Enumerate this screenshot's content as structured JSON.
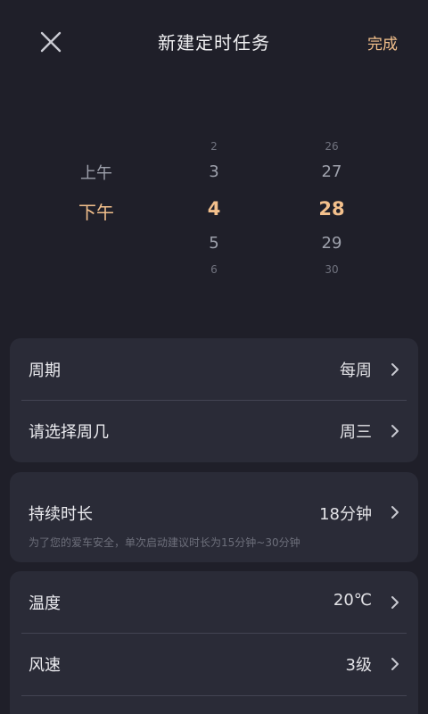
{
  "header": {
    "title": "新建定时任务",
    "done_label": "完成",
    "close_icon": "close-icon"
  },
  "picker": {
    "ampm": {
      "above": "上午",
      "selected": "下午"
    },
    "hours": {
      "above2": "2",
      "above1": "3",
      "selected": "4",
      "below1": "5",
      "below2": "6"
    },
    "minutes": {
      "above2": "26",
      "above1": "27",
      "selected": "28",
      "below1": "29",
      "below2": "30"
    }
  },
  "schedule_card": {
    "period": {
      "label": "周期",
      "value": "每周"
    },
    "weekday": {
      "label": "请选择周几",
      "value": "周三"
    }
  },
  "duration_card": {
    "label": "持续时长",
    "value": "18分钟",
    "hint": "为了您的爱车安全，单次启动建议时长为15分钟~30分钟"
  },
  "climate_card": {
    "temperature": {
      "label": "温度",
      "value": "20℃"
    },
    "fan": {
      "label": "风速",
      "value": "3级"
    }
  },
  "colors": {
    "accent": "#f3c08c",
    "background": "#1f1f29",
    "card": "#2a2b37"
  }
}
